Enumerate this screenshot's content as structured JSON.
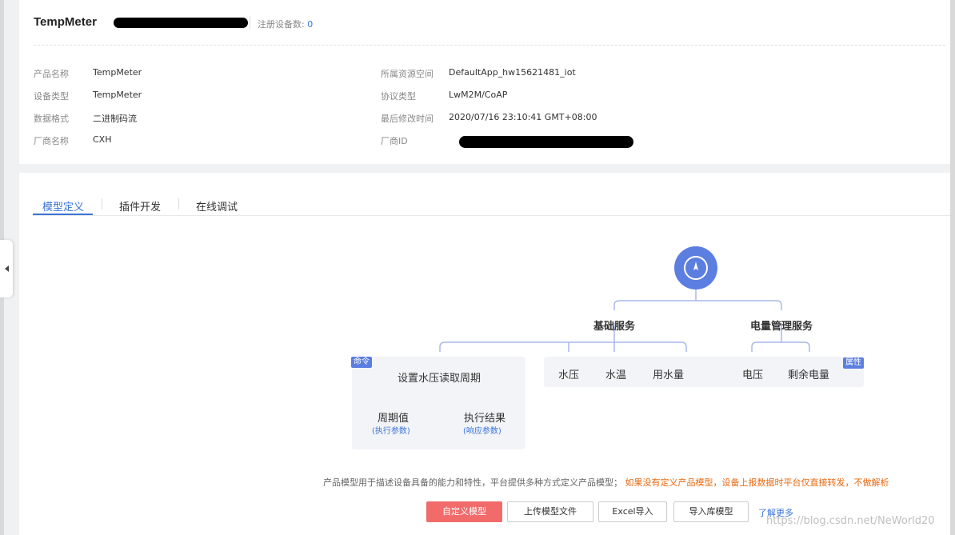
{
  "product": {
    "name": "TempMeter",
    "registered_label": "注册设备数:",
    "registered_count": "0"
  },
  "info": {
    "product_name_label": "产品名称",
    "product_name": "TempMeter",
    "device_type_label": "设备类型",
    "device_type": "TempMeter",
    "data_format_label": "数据格式",
    "data_format": "二进制码流",
    "vendor_name_label": "厂商名称",
    "vendor_name": "CXH",
    "resource_space_label": "所属资源空间",
    "resource_space": "DefaultApp_hw15621481_iot",
    "protocol_label": "协议类型",
    "protocol": "LwM2M/CoAP",
    "modified_label": "最后修改时间",
    "modified": "2020/07/16 23:10:41 GMT+08:00",
    "vendor_id_label": "厂商ID"
  },
  "tabs": [
    {
      "label": "模型定义",
      "active": true
    },
    {
      "label": "插件开发",
      "active": false
    },
    {
      "label": "在线调试",
      "active": false
    }
  ],
  "model": {
    "services": [
      "基础服务",
      "电量管理服务"
    ],
    "command_tag": "命令",
    "property_tag": "属性",
    "command_name": "设置水压读取周期",
    "command_params": [
      {
        "name": "周期值",
        "sub": "(执行参数)"
      },
      {
        "name": "执行结果",
        "sub": "(响应参数)"
      }
    ],
    "basic_properties": [
      "水压",
      "水温",
      "用水量"
    ],
    "power_properties": [
      "电压",
      "剩余电量"
    ]
  },
  "description": {
    "normal": "产品模型用于描述设备具备的能力和特性，平台提供多种方式定义产品模型；",
    "warning": "如果没有定义产品模型，设备上报数据时平台仅直接转发，不做解析"
  },
  "buttons": {
    "custom": "自定义模型",
    "upload": "上传模型文件",
    "excel": "Excel导入",
    "library": "导入库模型"
  },
  "learn_more": "了解更多",
  "watermark": "https://blog.csdn.net/NeWorld20",
  "colors": {
    "accent": "#3a74d8",
    "node": "#5b7ee0",
    "primary_button": "#f26b6b",
    "warning": "#e86a12"
  }
}
